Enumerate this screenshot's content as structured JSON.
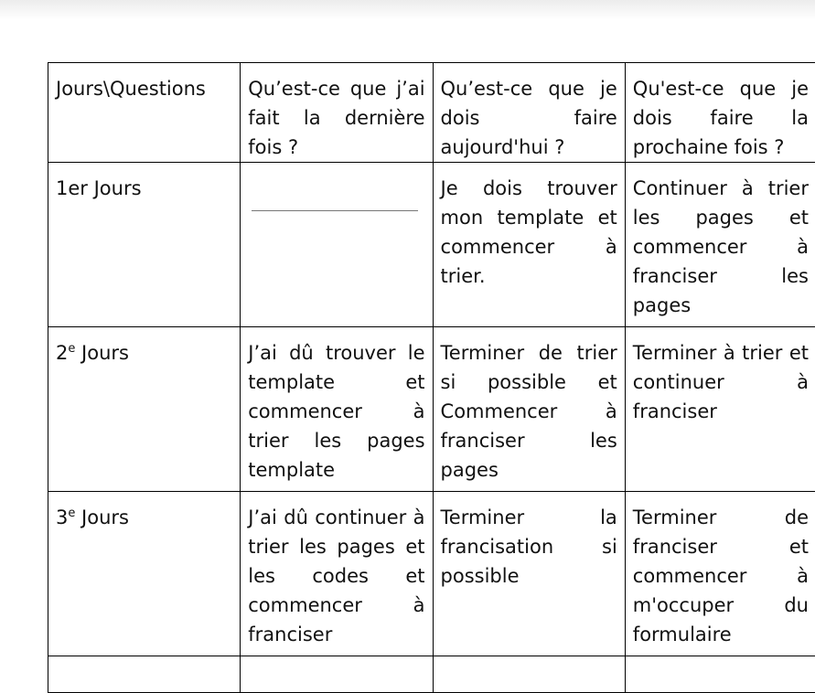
{
  "table": {
    "header": {
      "col0": "Jours\\Questions",
      "col1": "Qu’est-ce que j’ai fait la dernière fois ?",
      "col2": "Qu’est-ce que je dois faire aujourd'hui ?",
      "col3": "Qu'est-ce que je dois faire la prochaine fois ?"
    },
    "rows": [
      {
        "day": "1er Jours",
        "last_time": "",
        "today": "Je dois trouver mon template et commencer à trier.",
        "next_time": "Continuer à trier les pages et commencer à franciser les pages"
      },
      {
        "day_num": "2",
        "day_sup": "e",
        "day_word": " Jours",
        "last_time": "J’ai dû trouver le template et commencer à trier les pages template",
        "today": "Terminer de trier si possible et Commencer à franciser les pages",
        "next_time": "Terminer à trier et continuer à franciser"
      },
      {
        "day_num": "3",
        "day_sup": "e",
        "day_word": " Jours",
        "last_time": "J’ai dû continuer à trier les pages et les codes et commencer à franciser",
        "today": "Terminer la francisation si possible",
        "next_time": "Terminer de franciser et commencer à m'occuper du formulaire"
      }
    ]
  }
}
